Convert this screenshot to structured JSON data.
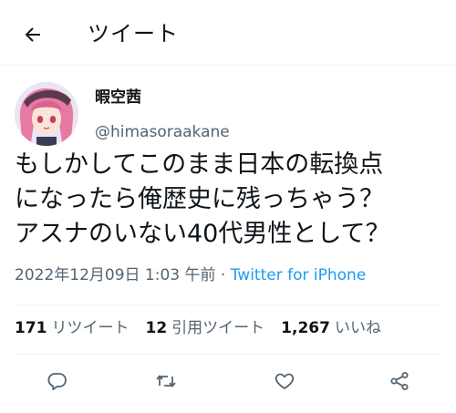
{
  "header": {
    "back_icon": "arrow-left-icon",
    "title": "ツイート"
  },
  "author": {
    "display_name": "暇空茜",
    "handle": "@himasoraakane",
    "avatar_icon": "avatar-image"
  },
  "tweet": {
    "lines": [
      "もしかしてこのまま日本の転換点",
      "になったら俺歴史に残っちゃう？",
      "アスナのいない40代男性として？"
    ],
    "timestamp": "2022年12月09日 1:03 午前",
    "separator": " · ",
    "source": "Twitter for iPhone",
    "source_color": "#1d9bf0"
  },
  "stats": {
    "retweets": {
      "count": "171",
      "label": "リツイート"
    },
    "quotes": {
      "count": "12",
      "label": "引用ツイート"
    },
    "likes": {
      "count": "1,267",
      "label": "いいね"
    }
  },
  "actions": [
    {
      "icon": "reply-icon"
    },
    {
      "icon": "retweet-icon"
    },
    {
      "icon": "like-icon"
    },
    {
      "icon": "share-icon"
    }
  ],
  "colors": {
    "text": "#0f1419",
    "secondary": "#536471",
    "divider": "#eff3f4"
  }
}
